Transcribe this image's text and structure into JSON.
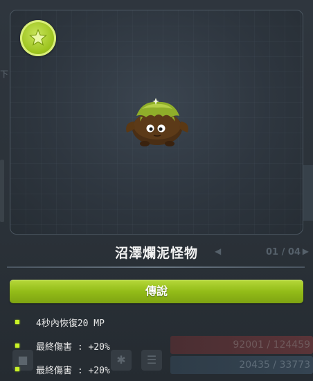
{
  "monster": {
    "name": "沼澤爛泥怪物"
  },
  "pager": {
    "counter": "01 / 04",
    "prev_glyph": "◀",
    "next_glyph": "▶"
  },
  "grade": {
    "label": "傳說",
    "color": "#93bc18"
  },
  "options": [
    {
      "text": "4秒內恢復20 MP"
    },
    {
      "text": "最終傷害 : +20%"
    },
    {
      "text": "最終傷害 : +20%"
    }
  ],
  "background_hints": {
    "hp_readout": "92001 / 124459",
    "mp_readout": "20435 / 33773",
    "left_char": "下"
  },
  "badge": {
    "icon": "star-icon",
    "color": "#9dc41f"
  },
  "accent_colors": {
    "bullet": "#c9f227",
    "panel_border": "#4a555f"
  }
}
